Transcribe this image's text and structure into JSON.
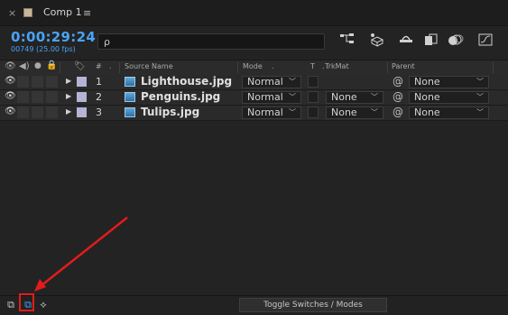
{
  "tab": {
    "close": "×",
    "title": "Comp 1",
    "menu": "≡"
  },
  "timecode": {
    "time": "0:00:29:24",
    "frames": "00749 (25.00 fps)"
  },
  "search": {
    "icon": "ρ",
    "placeholder": ""
  },
  "toolbar_icons": [
    "comp-flowchart-icon",
    "draft-3d-icon",
    "shy-layers-icon",
    "frame-blending-icon",
    "motion-blur-icon",
    "graph-editor-icon"
  ],
  "headers": {
    "hash": "#",
    "source_name": "Source Name",
    "mode": "Mode",
    "t": "T",
    "trkmat": "TrkMat",
    "parent": "Parent"
  },
  "layers": [
    {
      "num": "1",
      "name": "Lighthouse.jpg",
      "mode": "Normal",
      "trkmat": "",
      "parent": "None"
    },
    {
      "num": "2",
      "name": "Penguins.jpg",
      "mode": "Normal",
      "trkmat": "None",
      "parent": "None"
    },
    {
      "num": "3",
      "name": "Tulips.jpg",
      "mode": "Normal",
      "trkmat": "None",
      "parent": "None"
    }
  ],
  "footer": {
    "toggle_label": "Toggle Switches / Modes"
  },
  "colors": {
    "timecode": "#4aa3f5",
    "label": "#b4b4d4",
    "annotation": "#e41b1b"
  }
}
